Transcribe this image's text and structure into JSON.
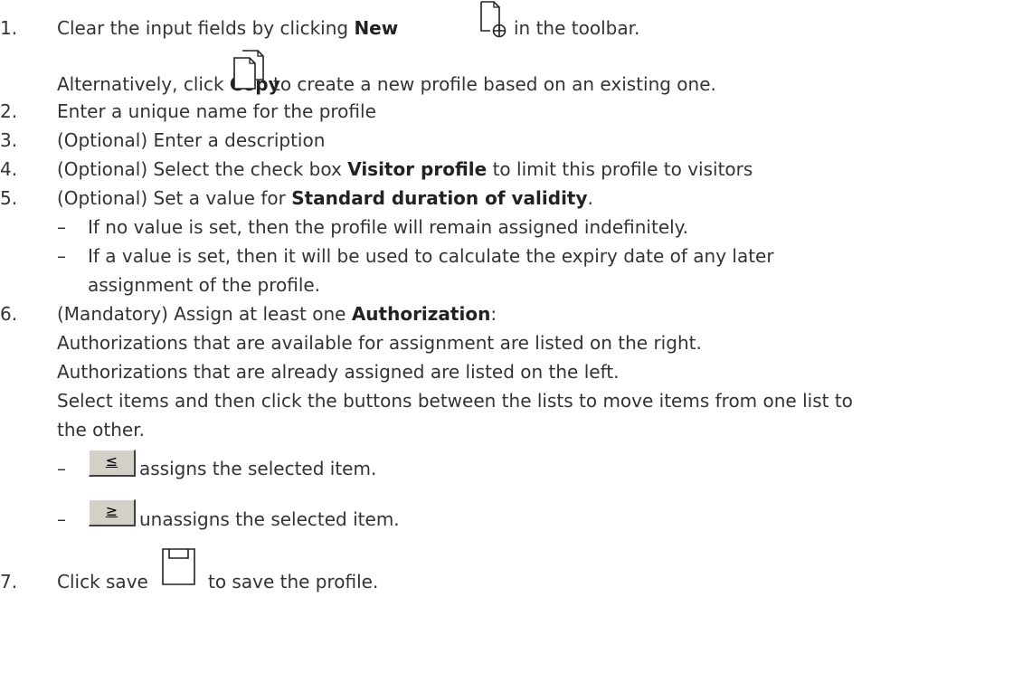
{
  "steps": [
    {
      "number": "1.",
      "line1_pre": "Clear the input fields by clicking ",
      "line1_bold": "New",
      "line1_post": " in the toolbar.",
      "line2_pre": "Alternatively, click ",
      "line2_bold": "Copy",
      "line2_post": " to create a new profile based on an existing one."
    },
    {
      "number": "2.",
      "text": "Enter a unique name for the profile"
    },
    {
      "number": "3.",
      "text": "(Optional) Enter a description"
    },
    {
      "number": "4.",
      "pre": "(Optional) Select the check box ",
      "bold": "Visitor profile",
      "post": " to limit this profile to visitors"
    },
    {
      "number": "5.",
      "pre": "(Optional) Set a value for ",
      "bold": "Standard duration of validity",
      "post": ".",
      "bullets": [
        "If no value is set, then the profile will remain assigned indefinitely.",
        "If a value is set, then it will be used to calculate the expiry date of any later",
        "assignment of the profile."
      ]
    },
    {
      "number": "6.",
      "pre": "(Mandatory) Assign at least one ",
      "bold": "Authorization",
      "post": ":",
      "lines": [
        "Authorizations that are available for assignment are listed on the right.",
        "Authorizations that are already assigned are listed on the left.",
        "Select items and then click the buttons between the lists to move items from one list to",
        "the other."
      ],
      "assign_button": "≤",
      "assign_text": "assigns the selected item.",
      "unassign_button": "≥",
      "unassign_text": "unassigns the selected item."
    },
    {
      "number": "7.",
      "pre": "Click save",
      "post": "to save the profile."
    }
  ],
  "dash": "–",
  "icons": [
    "new-document-icon",
    "copy-documents-icon",
    "save-icon"
  ]
}
